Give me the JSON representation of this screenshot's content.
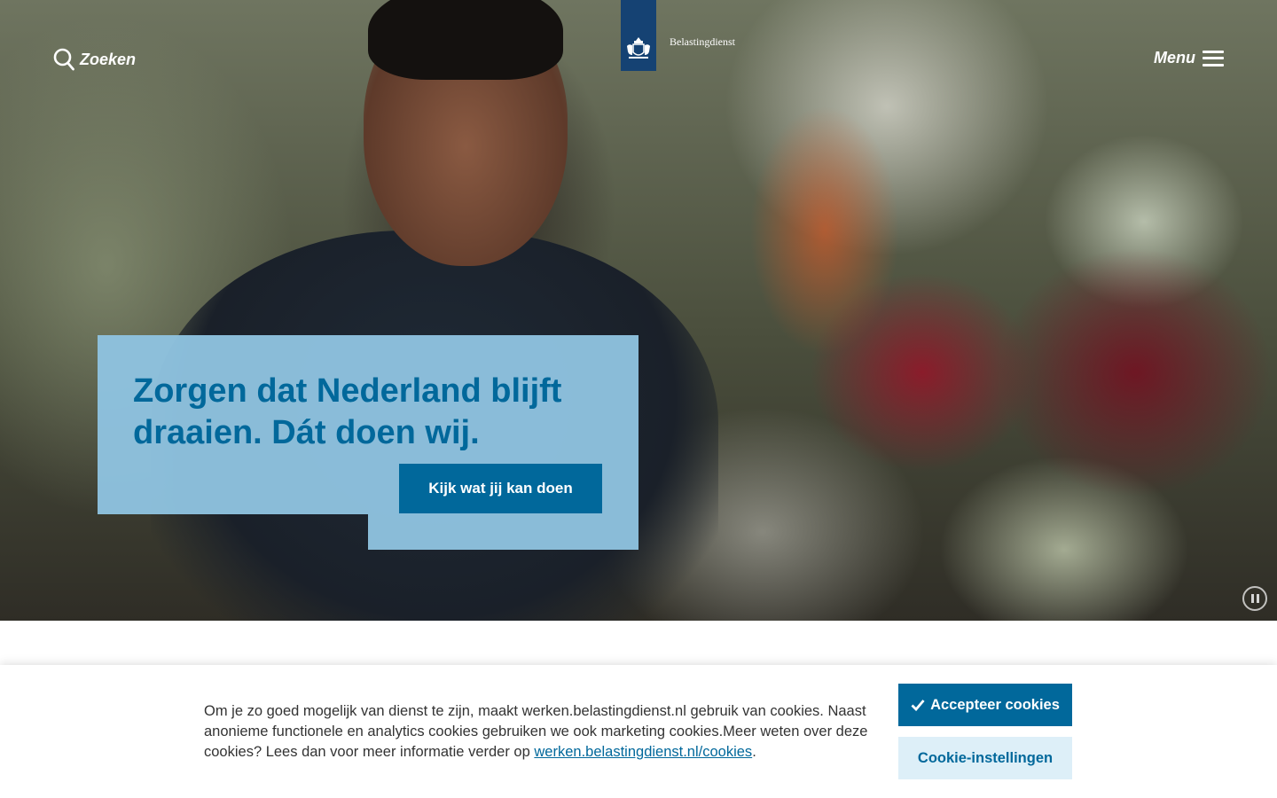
{
  "header": {
    "search_label": "Zoeken",
    "menu_label": "Menu",
    "logo_text": "Belastingdienst"
  },
  "hero": {
    "title_regular": "Zorgen dat Nederland blijft draaien.",
    "title_bold": "Dát doen wij.",
    "cta_label": "Kijk wat jij kan doen"
  },
  "cookie_banner": {
    "text": "Om je zo goed mogelijk van dienst te zijn, maakt werken.belastingdienst.nl gebruik van cookies. Naast anonieme functionele en analytics cookies gebruiken we ook marketing cookies.Meer weten over deze cookies? Lees dan voor meer informatie verder op",
    "link_text": "werken.belastingdienst.nl/cookies",
    "trailing": ".",
    "accept_label": "Accepteer cookies",
    "settings_label": "Cookie-instellingen"
  },
  "colors": {
    "primary": "#01689b",
    "logo_blue": "#154273",
    "card_bg": "#8fc3e0",
    "settings_bg": "#ddeff8"
  }
}
